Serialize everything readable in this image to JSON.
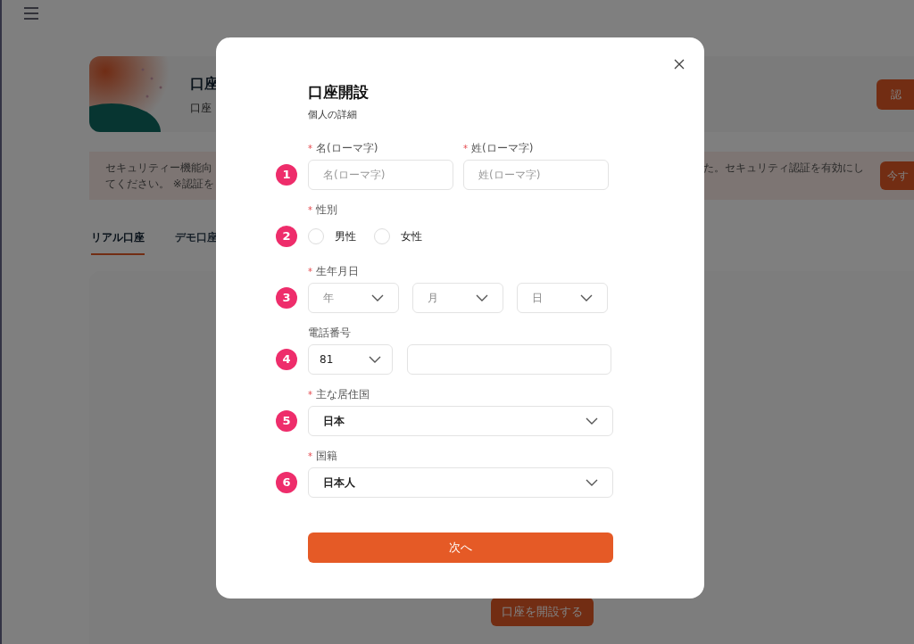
{
  "page": {
    "header": {
      "title": "口座",
      "subtitle": "口座",
      "button": "認"
    },
    "notice": {
      "left_lines": [
        "セキュリティー機能向",
        "てください。 ※認証を"
      ],
      "right_text": "た。セキュリティ認証を有効にし",
      "button": "今す"
    },
    "tabs": [
      {
        "label": "リアル口座",
        "selected": true
      },
      {
        "label": "デモ口座",
        "selected": false
      }
    ],
    "open_button": "口座を開設する"
  },
  "dialog": {
    "title": "口座開設",
    "subtitle": "個人の詳細",
    "fields": [
      {
        "kind": "name_pair",
        "step": "1",
        "items": [
          {
            "mark": "*",
            "label": "名(ローマ字)",
            "placeholder": "名(ローマ字)"
          },
          {
            "mark": "*",
            "label": "姓(ローマ字)",
            "placeholder": "姓(ローマ字)"
          }
        ]
      },
      {
        "kind": "radio",
        "step": "2",
        "mark": "*",
        "label": "性別",
        "options": [
          {
            "label": "男性",
            "selected": false
          },
          {
            "label": "女性",
            "selected": false
          }
        ]
      },
      {
        "kind": "date",
        "step": "3",
        "mark": "*",
        "label": "生年月日",
        "selects": [
          {
            "placeholder": "年"
          },
          {
            "placeholder": "月"
          },
          {
            "placeholder": "日"
          }
        ]
      },
      {
        "kind": "phone",
        "step": "4",
        "label": "電話番号",
        "code": "81"
      },
      {
        "kind": "select",
        "step": "5",
        "mark": "*",
        "label": "主な居住国",
        "value": "日本"
      },
      {
        "kind": "select",
        "step": "6",
        "mark": "*",
        "label": "国籍",
        "value": "日本人"
      }
    ],
    "next_button": "次へ"
  }
}
